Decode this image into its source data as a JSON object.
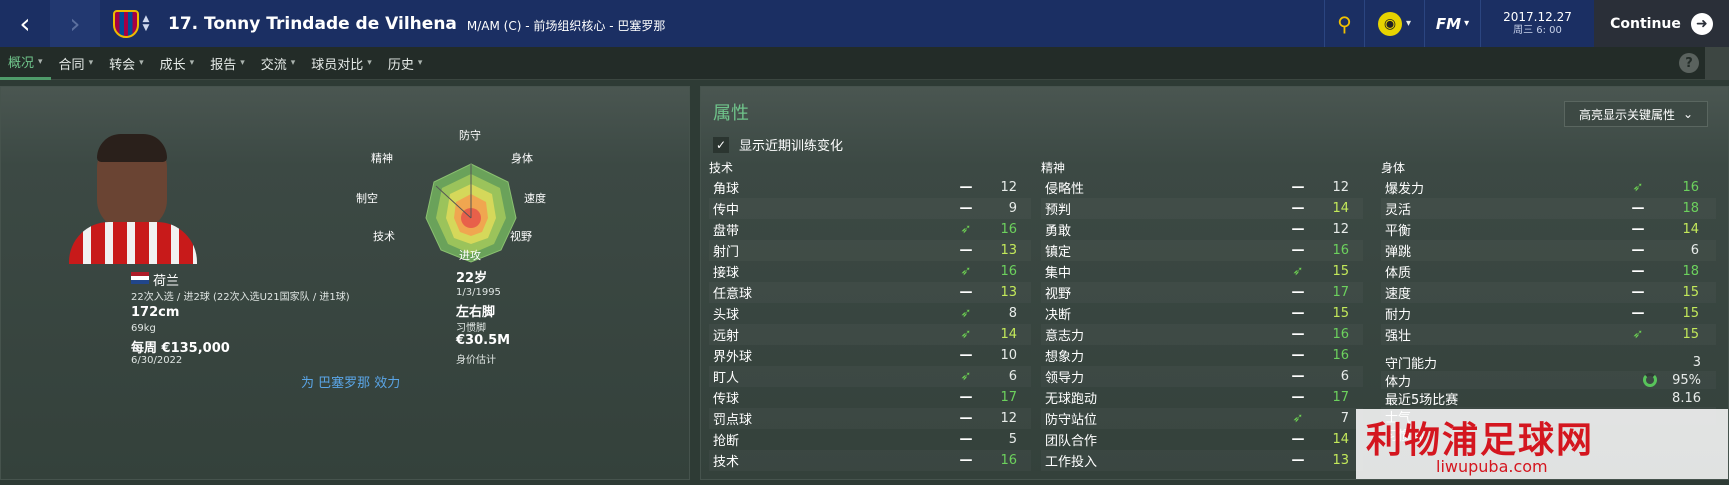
{
  "header": {
    "back": "‹",
    "forward": "›",
    "player_title": "17. Tonny Trindade de Vilhena",
    "subtitle": "M/AM (C) - 前场组织核心 - 巴塞罗那",
    "search_icon": "search-icon",
    "fm": "FM",
    "date": "2017.12.27",
    "time": "周三 6: 00",
    "continue": "Continue"
  },
  "tabs": [
    {
      "label": "概况",
      "active": true
    },
    {
      "label": "合同"
    },
    {
      "label": "转会"
    },
    {
      "label": "成长"
    },
    {
      "label": "报告"
    },
    {
      "label": "交流"
    },
    {
      "label": "球员对比"
    },
    {
      "label": "历史"
    }
  ],
  "help": "?",
  "profile": {
    "nation": "荷兰",
    "caps": "22次入选 / 进2球 (22次入选U21国家队 / 进1球)",
    "height": "172cm",
    "weight": "69kg",
    "wage": "每周 €135,000",
    "contract_end": "6/30/2022",
    "age": "22岁",
    "dob": "1/3/1995",
    "foot": "左右脚",
    "foot_label": "习惯脚",
    "value": "€30.5M",
    "value_label": "身价估计",
    "plays_for": "为 巴塞罗那 效力"
  },
  "radar": {
    "defense": "防守",
    "physical": "身体",
    "speed": "速度",
    "vision": "视野",
    "attack": "进攻",
    "technique": "技术",
    "aerial": "制空",
    "mental": "精神"
  },
  "attributes": {
    "title": "属性",
    "highlight_label": "高亮显示关键属性",
    "show_training": "显示近期训练变化",
    "technical_head": "技术",
    "mental_head": "精神",
    "physical_head": "身体",
    "technical": [
      {
        "name": "角球",
        "ind": "—",
        "val": "12"
      },
      {
        "name": "传中",
        "ind": "—",
        "val": "9"
      },
      {
        "name": "盘带",
        "ind": "▲",
        "val": "16"
      },
      {
        "name": "射门",
        "ind": "—",
        "val": "13"
      },
      {
        "name": "接球",
        "ind": "▲",
        "val": "16"
      },
      {
        "name": "任意球",
        "ind": "—",
        "val": "13"
      },
      {
        "name": "头球",
        "ind": "▲",
        "val": "8"
      },
      {
        "name": "远射",
        "ind": "▲",
        "val": "14"
      },
      {
        "name": "界外球",
        "ind": "—",
        "val": "10"
      },
      {
        "name": "盯人",
        "ind": "▲",
        "val": "6"
      },
      {
        "name": "传球",
        "ind": "—",
        "val": "17"
      },
      {
        "name": "罚点球",
        "ind": "—",
        "val": "12"
      },
      {
        "name": "抢断",
        "ind": "—",
        "val": "5"
      },
      {
        "name": "技术",
        "ind": "—",
        "val": "16"
      }
    ],
    "mental": [
      {
        "name": "侵略性",
        "ind": "—",
        "val": "12"
      },
      {
        "name": "预判",
        "ind": "—",
        "val": "14"
      },
      {
        "name": "勇敢",
        "ind": "—",
        "val": "12"
      },
      {
        "name": "镇定",
        "ind": "—",
        "val": "16"
      },
      {
        "name": "集中",
        "ind": "▲",
        "val": "15"
      },
      {
        "name": "视野",
        "ind": "—",
        "val": "17"
      },
      {
        "name": "决断",
        "ind": "—",
        "val": "15"
      },
      {
        "name": "意志力",
        "ind": "—",
        "val": "16"
      },
      {
        "name": "想象力",
        "ind": "—",
        "val": "16"
      },
      {
        "name": "领导力",
        "ind": "—",
        "val": "6"
      },
      {
        "name": "无球跑动",
        "ind": "—",
        "val": "17"
      },
      {
        "name": "防守站位",
        "ind": "▲",
        "val": "7"
      },
      {
        "name": "团队合作",
        "ind": "—",
        "val": "14"
      },
      {
        "name": "工作投入",
        "ind": "—",
        "val": "13"
      }
    ],
    "physical": [
      {
        "name": "爆发力",
        "ind": "▲",
        "val": "16"
      },
      {
        "name": "灵活",
        "ind": "—",
        "val": "18"
      },
      {
        "name": "平衡",
        "ind": "—",
        "val": "14"
      },
      {
        "name": "弹跳",
        "ind": "—",
        "val": "6"
      },
      {
        "name": "体质",
        "ind": "—",
        "val": "18"
      },
      {
        "name": "速度",
        "ind": "—",
        "val": "15"
      },
      {
        "name": "耐力",
        "ind": "—",
        "val": "15"
      },
      {
        "name": "强壮",
        "ind": "▲",
        "val": "15"
      }
    ],
    "extra": [
      {
        "name": "守门能力",
        "val": "3"
      },
      {
        "name": "体力",
        "val": "95%"
      },
      {
        "name": "最近5场比赛",
        "val": "8.16"
      },
      {
        "name": "士气",
        "val": ""
      },
      {
        "name": "习惯脚",
        "val": ""
      }
    ]
  },
  "watermark": {
    "main": "利物浦足球网",
    "sub": "liwupuba.com"
  },
  "colors": {
    "topbar": "#1b2f63",
    "accent_green": "#6fc38a",
    "value_green": "#6cd15d",
    "value_lime": "#c3e95a",
    "link_blue": "#5aa5e6"
  }
}
